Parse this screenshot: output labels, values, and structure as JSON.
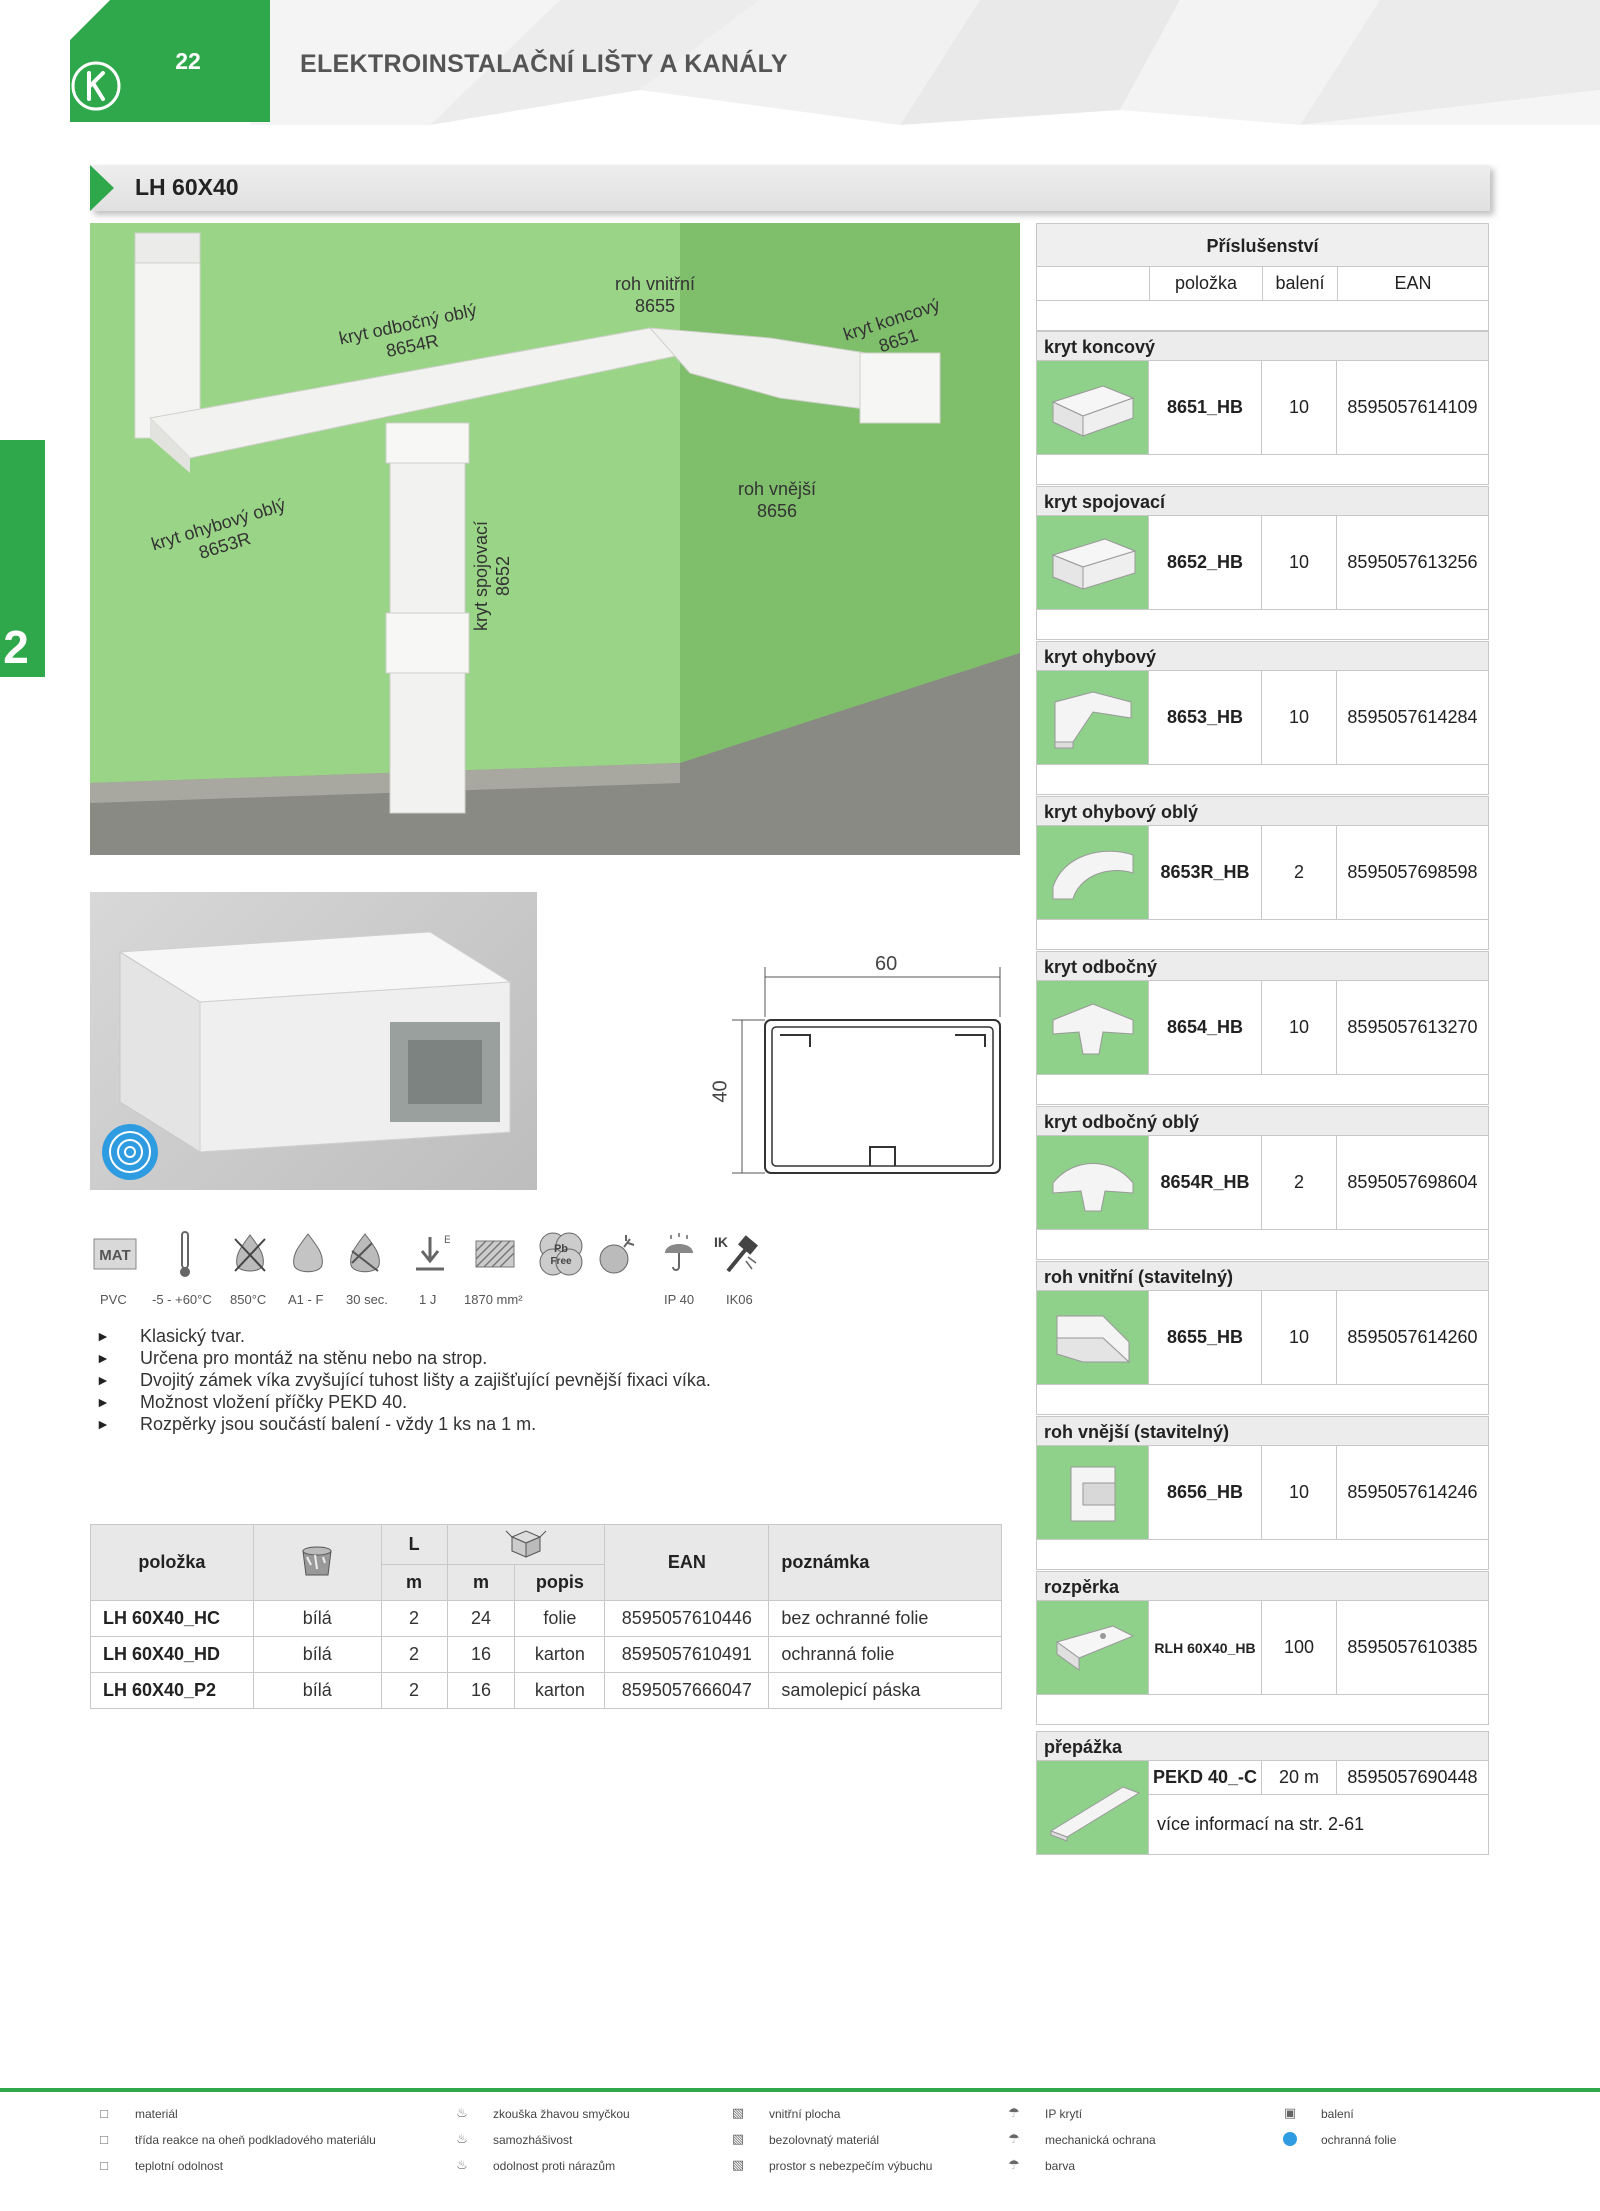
{
  "header": {
    "page_number": "22",
    "title": "ELEKTROINSTALAČNÍ LIŠTY A KANÁLY",
    "brand_color": "#2ea84a"
  },
  "side_tab": {
    "label": "2"
  },
  "product": {
    "title": "LH 60X40"
  },
  "photo_callouts": [
    {
      "name": "kryt odbočný oblý",
      "code": "8654R"
    },
    {
      "name": "roh vnitřní",
      "code": "8655"
    },
    {
      "name": "kryt koncový",
      "code": "8651"
    },
    {
      "name": "roh vnější",
      "code": "8656"
    },
    {
      "name": "kryt ohybový oblý",
      "code": "8653R"
    },
    {
      "name": "kryt spojovací",
      "code": "8652"
    }
  ],
  "drawing": {
    "width": "60",
    "height": "40"
  },
  "properties": [
    {
      "icon": "mat-icon",
      "label": "PVC"
    },
    {
      "icon": "thermometer-icon",
      "label": "-5 - +60°C"
    },
    {
      "icon": "glow-wire-icon",
      "label": "850°C"
    },
    {
      "icon": "flame-icon",
      "label": "A1 - F"
    },
    {
      "icon": "self-extinguish-icon",
      "label": "30 sec."
    },
    {
      "icon": "impact-icon",
      "label": "1 J"
    },
    {
      "icon": "surface-icon",
      "label": "1870 mm²"
    },
    {
      "icon": "pb-free-icon",
      "label": ""
    },
    {
      "icon": "explosion-icon",
      "label": ""
    },
    {
      "icon": "ip-icon",
      "label": "IP 40"
    },
    {
      "icon": "ik-hammer-icon",
      "label": "IK06"
    }
  ],
  "bullets": [
    "Klasický tvar.",
    "Určena pro montáž na stěnu nebo na strop.",
    "Dvojitý zámek víka zvyšující tuhost lišty a zajišťující pevnější fixaci víka.",
    "Možnost vložení příčky PEKD 40.",
    "Rozpěrky jsou součástí balení - vždy 1 ks na 1 m."
  ],
  "product_table": {
    "headers": {
      "item": "položka",
      "length_top": "L",
      "length_unit": "m",
      "pack_unit": "m",
      "pack_desc": "popis",
      "ean": "EAN",
      "note": "poznámka"
    },
    "rows": [
      {
        "item": "LH 60X40_HC",
        "color": "bílá",
        "length": "2",
        "pack": "24",
        "desc": "folie",
        "ean": "8595057610446",
        "note": "bez ochranné folie"
      },
      {
        "item": "LH 60X40_HD",
        "color": "bílá",
        "length": "2",
        "pack": "16",
        "desc": "karton",
        "ean": "8595057610491",
        "note": "ochranná folie"
      },
      {
        "item": "LH 60X40_P2",
        "color": "bílá",
        "length": "2",
        "pack": "16",
        "desc": "karton",
        "ean": "8595057666047",
        "note": "samolepicí páska"
      }
    ]
  },
  "accessories": {
    "title": "Příslušenství",
    "columns": [
      "položka",
      "balení",
      "EAN"
    ],
    "items": [
      {
        "name": "kryt koncový",
        "code": "8651_HB",
        "qty": "10",
        "ean": "8595057614109"
      },
      {
        "name": "kryt spojovací",
        "code": "8652_HB",
        "qty": "10",
        "ean": "8595057613256"
      },
      {
        "name": "kryt ohybový",
        "code": "8653_HB",
        "qty": "10",
        "ean": "8595057614284"
      },
      {
        "name": "kryt ohybový oblý",
        "code": "8653R_HB",
        "qty": "2",
        "ean": "8595057698598"
      },
      {
        "name": "kryt odbočný",
        "code": "8654_HB",
        "qty": "10",
        "ean": "8595057613270"
      },
      {
        "name": "kryt odbočný oblý",
        "code": "8654R_HB",
        "qty": "2",
        "ean": "8595057698604"
      },
      {
        "name": "roh vnitřní (stavitelný)",
        "code": "8655_HB",
        "qty": "10",
        "ean": "8595057614260"
      },
      {
        "name": "roh vnější (stavitelný)",
        "code": "8656_HB",
        "qty": "10",
        "ean": "8595057614246"
      },
      {
        "name": "rozpěrka",
        "code": "RLH 60X40_HB",
        "qty": "100",
        "ean": "8595057610385"
      }
    ],
    "divider": {
      "name": "přepážka",
      "code": "PEKD 40_-C",
      "qty": "20 m",
      "ean": "8595057690448",
      "more_info": "více informací na str. 2-61"
    }
  },
  "legend": [
    [
      "materiál",
      "třída reakce na oheň podkladového materiálu",
      "teplotní odolnost"
    ],
    [
      "zkouška žhavou smyčkou",
      "samozhášivost",
      "odolnost proti nárazům"
    ],
    [
      "vnitřní plocha",
      "bezolovnatý materiál",
      "prostor s nebezpečím výbuchu"
    ],
    [
      "IP krytí",
      "mechanická ochrana",
      "barva"
    ],
    [
      "balení",
      "ochranná folie"
    ]
  ]
}
